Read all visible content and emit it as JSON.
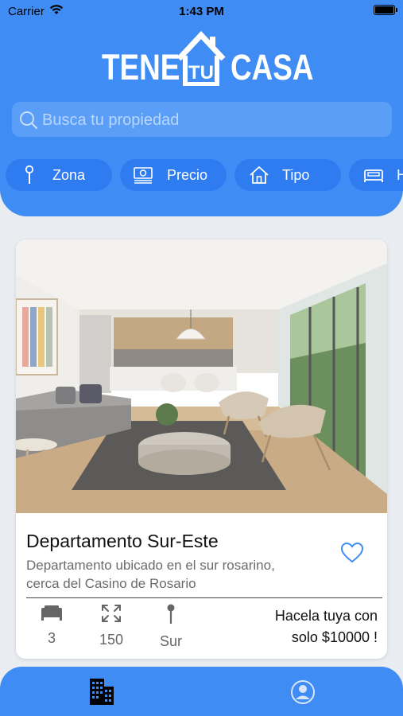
{
  "status_bar": {
    "carrier": "Carrier",
    "time": "1:43 PM"
  },
  "logo": {
    "word1": "TENE",
    "word2": "TU",
    "word3": "CASA"
  },
  "search": {
    "placeholder": "Busca tu propiedad",
    "icon": "search-icon"
  },
  "filters": [
    {
      "label": "Zona",
      "icon": "pin-icon"
    },
    {
      "label": "Precio",
      "icon": "money-icon"
    },
    {
      "label": "Tipo",
      "icon": "house-icon"
    },
    {
      "label": "H",
      "icon": "bed-icon"
    }
  ],
  "listing": {
    "title": "Departamento Sur-Este",
    "description_line1": "Departamento ubicado en el sur rosarino,",
    "description_line2": "cerca del Casino de Rosario",
    "features": [
      {
        "icon": "bed-icon",
        "value": "3"
      },
      {
        "icon": "expand-icon",
        "value": "150"
      },
      {
        "icon": "pin-icon",
        "value": "Sur"
      }
    ],
    "promo_line1": "Hacela tuya con",
    "promo_line2": "solo $10000 !"
  },
  "tabbar": {
    "tabs": [
      {
        "icon": "buildings-icon",
        "active": true
      },
      {
        "icon": "profile-icon",
        "active": false
      }
    ]
  },
  "colors": {
    "brand": "#3f8cf4",
    "chip": "#2f7bf0",
    "accent_heart": "#3f8cf4"
  }
}
